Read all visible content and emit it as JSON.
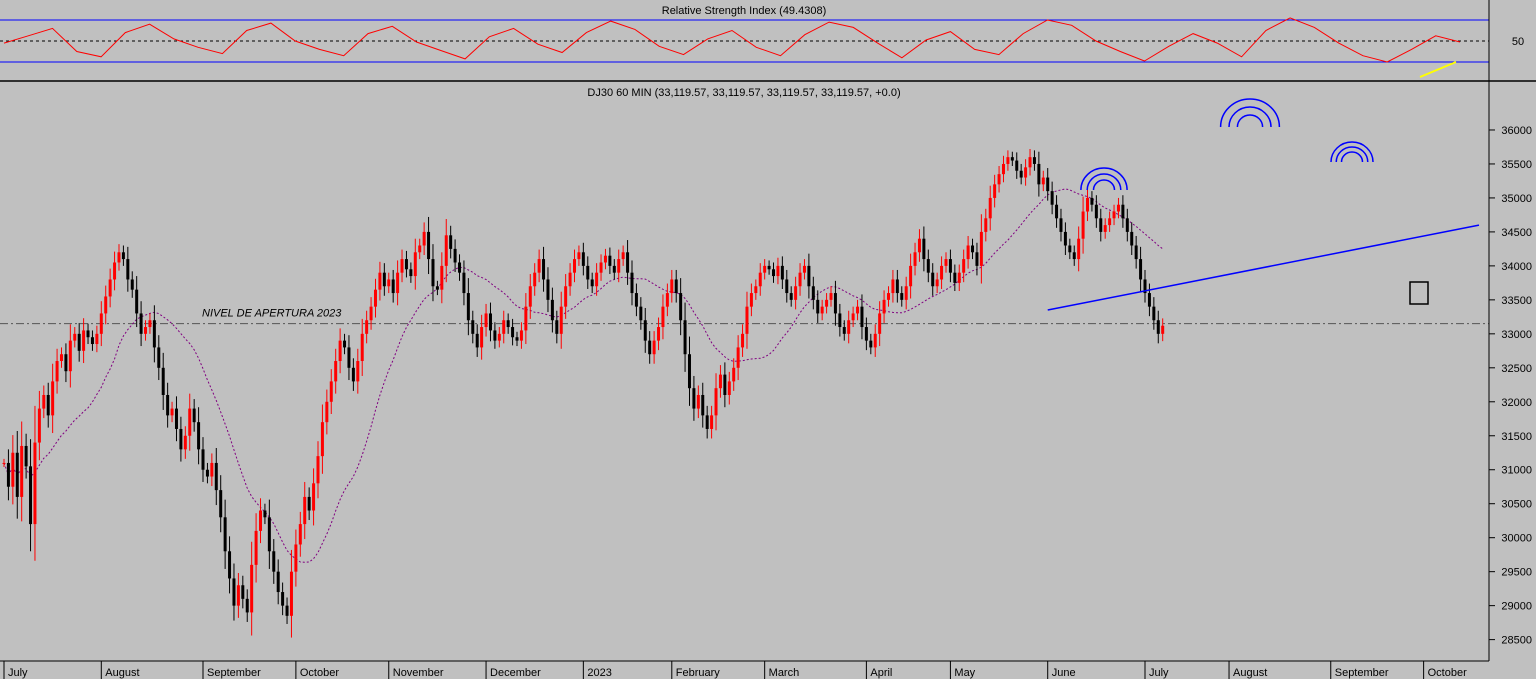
{
  "colors": {
    "background": "#c0c0c0",
    "rsi_line": "#ff0000",
    "rsi_bands": "#0000ff",
    "price_up": "#ff0000",
    "price_down": "#000000",
    "moving_average": "#800080",
    "trendline": "#0000ff",
    "rsi_trend_highlight": "#ffff00",
    "pattern_arcs": "#0000ff"
  },
  "rsi_panel": {
    "title": "Relative Strength Index (49.4308)",
    "tick_label": "50"
  },
  "chart_data": [
    {
      "type": "line",
      "title": "Relative Strength Index (49.4308)",
      "indicator": "RSI",
      "current_value": 49.4308,
      "upper_band": 70,
      "lower_band": 30,
      "midline": 50,
      "y_ticks": [
        50
      ],
      "ylim": [
        0,
        100
      ],
      "series": [
        {
          "name": "Relative Strength Index",
          "values": [
            48,
            55,
            62,
            40,
            35,
            58,
            66,
            52,
            44,
            38,
            60,
            67,
            50,
            42,
            36,
            57,
            64,
            49,
            41,
            33,
            54,
            62,
            47,
            39,
            58,
            69,
            61,
            45,
            37,
            52,
            60,
            44,
            36,
            56,
            68,
            63,
            48,
            34,
            51,
            59,
            42,
            37,
            57,
            70,
            65,
            50,
            40,
            31,
            45,
            57,
            48,
            35,
            60,
            72,
            63,
            48,
            36,
            30,
            42,
            55,
            49
          ]
        }
      ]
    },
    {
      "type": "candlestick",
      "title": "DJ30 60 MIN (33,119.57, 33,119.57, 33,119.57, 33,119.57, +0.0)",
      "symbol": "DJ30",
      "timeframe": "60 MIN",
      "last_ohlc": {
        "open": 33119.57,
        "high": 33119.57,
        "low": 33119.57,
        "close": 33119.57,
        "change": 0.0
      },
      "ylim": [
        28200,
        36500
      ],
      "y_ticks": [
        28500,
        29000,
        29500,
        30000,
        30500,
        31000,
        31500,
        32000,
        32500,
        33000,
        33500,
        34000,
        34500,
        35000,
        35500,
        36000
      ],
      "x_labels": [
        {
          "label": "July",
          "idx": 0
        },
        {
          "label": "August",
          "idx": 22
        },
        {
          "label": "September",
          "idx": 45
        },
        {
          "label": "October",
          "idx": 66
        },
        {
          "label": "November",
          "idx": 87
        },
        {
          "label": "December",
          "idx": 109
        },
        {
          "label": "2023",
          "idx": 131
        },
        {
          "label": "February",
          "idx": 151
        },
        {
          "label": "March",
          "idx": 172
        },
        {
          "label": "April",
          "idx": 195
        },
        {
          "label": "May",
          "idx": 214
        },
        {
          "label": "June",
          "idx": 236
        },
        {
          "label": "July",
          "idx": 258
        },
        {
          "label": "August",
          "idx": 277
        },
        {
          "label": "September",
          "idx": 300
        },
        {
          "label": "October",
          "idx": 321
        }
      ],
      "total_periods": 330,
      "closes": [
        31100,
        30750,
        31250,
        30600,
        31350,
        31050,
        30200,
        31400,
        31900,
        32100,
        31800,
        32300,
        32600,
        32700,
        32450,
        32900,
        33000,
        32750,
        33050,
        32950,
        32850,
        33000,
        33300,
        33550,
        33800,
        34050,
        34200,
        34100,
        33800,
        33650,
        33300,
        33000,
        33100,
        33200,
        32800,
        32500,
        32100,
        31800,
        31900,
        31600,
        31300,
        31500,
        31900,
        31700,
        31300,
        31000,
        30900,
        31100,
        30700,
        30300,
        29800,
        29400,
        29000,
        29300,
        29100,
        28900,
        29600,
        30100,
        30400,
        30300,
        29800,
        29500,
        29200,
        29000,
        28850,
        29500,
        29900,
        30200,
        30600,
        30400,
        30800,
        31200,
        31700,
        32000,
        32300,
        32600,
        32900,
        32800,
        32500,
        32300,
        32600,
        33000,
        33200,
        33400,
        33650,
        33900,
        33700,
        33800,
        33600,
        33900,
        34100,
        33950,
        33850,
        34200,
        34300,
        34500,
        34100,
        33700,
        33650,
        34000,
        34450,
        34250,
        34050,
        33900,
        33600,
        33200,
        33000,
        32800,
        33100,
        33300,
        33050,
        32900,
        33000,
        33200,
        33100,
        32950,
        32900,
        33050,
        33400,
        33700,
        33900,
        34100,
        33800,
        33500,
        33200,
        33000,
        33400,
        33700,
        33900,
        34100,
        34200,
        34000,
        33800,
        33700,
        33900,
        34050,
        34150,
        34000,
        33900,
        34100,
        34200,
        33900,
        33600,
        33400,
        33200,
        32900,
        32700,
        32900,
        33100,
        33400,
        33600,
        33800,
        33600,
        33200,
        32700,
        32200,
        31900,
        32100,
        31800,
        31600,
        31800,
        32200,
        32400,
        32100,
        32300,
        32500,
        32800,
        33000,
        33400,
        33600,
        33700,
        33900,
        34000,
        33950,
        33850,
        34000,
        33800,
        33600,
        33500,
        33700,
        33900,
        34000,
        33700,
        33500,
        33300,
        33400,
        33500,
        33600,
        33300,
        33100,
        33000,
        33200,
        33300,
        33400,
        33100,
        32900,
        32800,
        33000,
        33300,
        33500,
        33600,
        33800,
        33600,
        33500,
        33700,
        34000,
        34200,
        34400,
        34100,
        33900,
        33700,
        33800,
        34000,
        34100,
        33900,
        33750,
        33900,
        34100,
        34300,
        34200,
        34000,
        34500,
        34700,
        35000,
        35200,
        35350,
        35500,
        35600,
        35550,
        35400,
        35300,
        35450,
        35600,
        35500,
        35200,
        35300,
        35100,
        34900,
        34700,
        34500,
        34300,
        34200,
        34100,
        34400,
        34800,
        35000,
        34900,
        34700,
        34500,
        34600,
        34700,
        34800,
        34900,
        34700,
        34500,
        34300,
        34100,
        33800,
        33600,
        33400,
        33200,
        33000,
        33119.57
      ]
    }
  ],
  "annotations": {
    "level_label": "NIVEL DE APERTURA 2023",
    "level_value": 33150,
    "trendline": {
      "from": {
        "idx": 236,
        "value": 33350
      },
      "to": {
        "idx": 330,
        "value": 34600
      }
    }
  }
}
